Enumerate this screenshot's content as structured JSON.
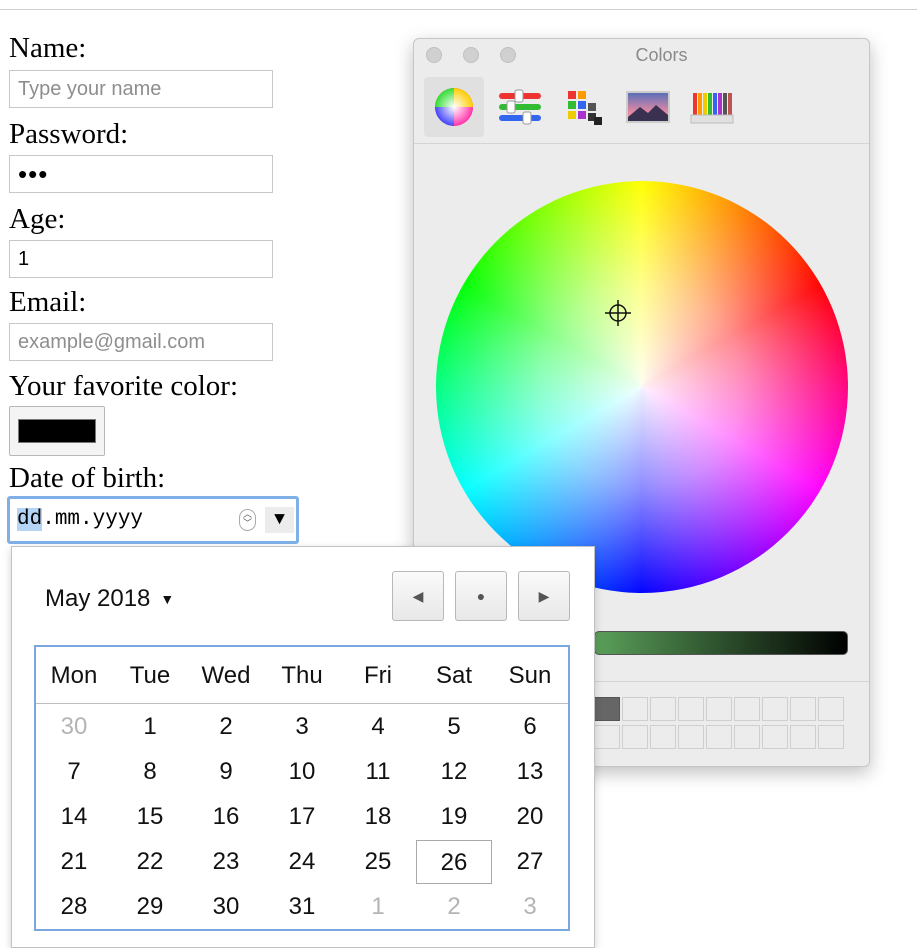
{
  "form": {
    "name_label": "Name:",
    "name_placeholder": "Type your name",
    "password_label": "Password:",
    "password_value": "•••",
    "age_label": "Age:",
    "age_value": "1",
    "email_label": "Email:",
    "email_placeholder": "example@gmail.com",
    "color_label": "Your favorite color:",
    "color_value": "#000000",
    "dob_label": "Date of birth:",
    "dob_day": "dd",
    "dob_rest": ".mm.yyyy"
  },
  "color_panel": {
    "title": "Colors",
    "tabs": [
      "color-wheel",
      "color-sliders",
      "color-palettes",
      "image-palettes",
      "pencils"
    ],
    "active_tab": "color-wheel",
    "brightness_start_color": "#5aa05a",
    "brightness_end_color": "#000000"
  },
  "calendar": {
    "month_label": "May 2018",
    "month_caret": "▼",
    "prev_glyph": "◀",
    "today_glyph": "●",
    "next_glyph": "▶",
    "weekdays": [
      "Mon",
      "Tue",
      "Wed",
      "Thu",
      "Fri",
      "Sat",
      "Sun"
    ],
    "weeks": [
      [
        {
          "d": "30",
          "other": true
        },
        {
          "d": "1"
        },
        {
          "d": "2"
        },
        {
          "d": "3"
        },
        {
          "d": "4"
        },
        {
          "d": "5"
        },
        {
          "d": "6"
        }
      ],
      [
        {
          "d": "7"
        },
        {
          "d": "8"
        },
        {
          "d": "9"
        },
        {
          "d": "10"
        },
        {
          "d": "11"
        },
        {
          "d": "12"
        },
        {
          "d": "13"
        }
      ],
      [
        {
          "d": "14"
        },
        {
          "d": "15"
        },
        {
          "d": "16"
        },
        {
          "d": "17"
        },
        {
          "d": "18"
        },
        {
          "d": "19"
        },
        {
          "d": "20"
        }
      ],
      [
        {
          "d": "21"
        },
        {
          "d": "22"
        },
        {
          "d": "23"
        },
        {
          "d": "24"
        },
        {
          "d": "25"
        },
        {
          "d": "26",
          "today": true
        },
        {
          "d": "27"
        }
      ],
      [
        {
          "d": "28"
        },
        {
          "d": "29"
        },
        {
          "d": "30"
        },
        {
          "d": "31"
        },
        {
          "d": "1",
          "other": true
        },
        {
          "d": "2",
          "other": true
        },
        {
          "d": "3",
          "other": true
        }
      ]
    ]
  }
}
